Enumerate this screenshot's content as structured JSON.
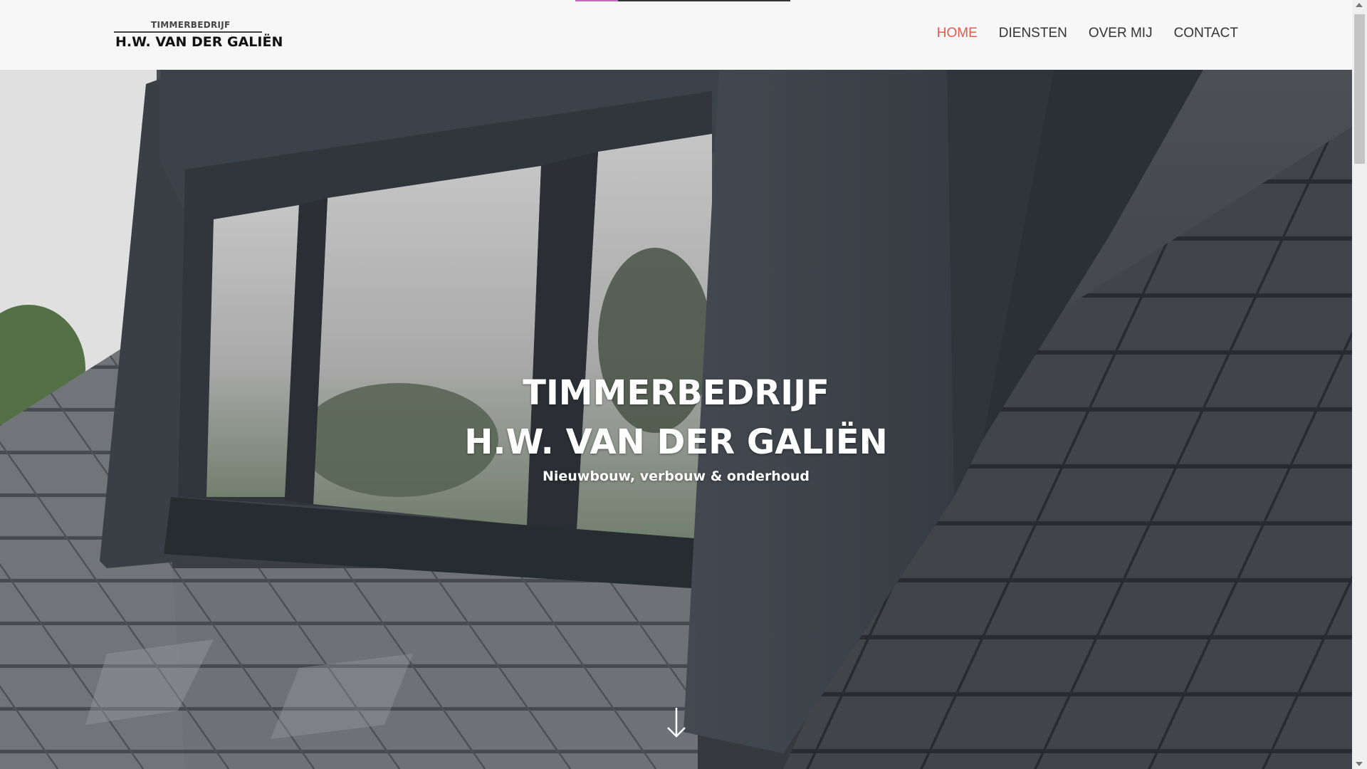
{
  "logo": {
    "top_line": "TIMMERBEDRIJF",
    "main_line": "H.W. VAN DER GALIËN"
  },
  "nav": {
    "items": [
      {
        "label": "HOME",
        "active": true
      },
      {
        "label": "DIENSTEN",
        "active": false
      },
      {
        "label": "OVER MIJ",
        "active": false
      },
      {
        "label": "CONTACT",
        "active": false
      }
    ],
    "active_color": "#e8584b"
  },
  "hero": {
    "title_line1": "TIMMERBEDRIJF",
    "title_line2": "H.W. VAN DER GALIËN",
    "subtitle": "Nieuwbouw, verbouw & onderhoud",
    "scroll_icon": "arrow-down-icon"
  },
  "page_progress": 0.2,
  "colors": {
    "header_bg": "#f7f7f8",
    "accent": "#e8584b",
    "progress": "#c06ac0"
  }
}
